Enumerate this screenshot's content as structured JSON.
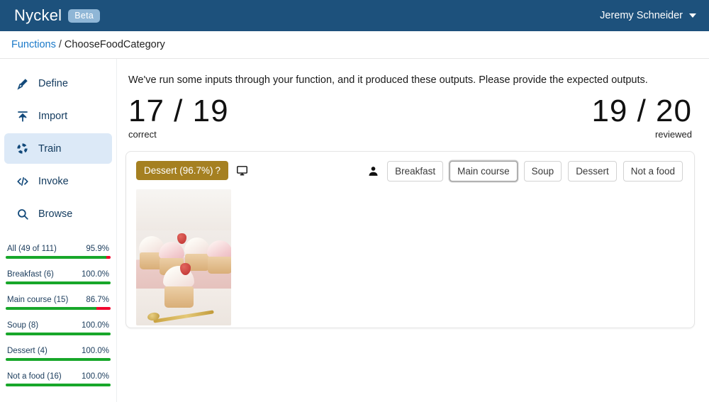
{
  "header": {
    "brand": "Nyckel",
    "beta_badge": "Beta",
    "user_name": "Jeremy Schneider",
    "bg_color": "#1d517c"
  },
  "breadcrumb": {
    "parent": "Functions",
    "separator": "/",
    "current": "ChooseFoodCategory"
  },
  "sidebar": {
    "items": [
      {
        "label": "Define",
        "icon": "brush-icon",
        "active": false
      },
      {
        "label": "Import",
        "icon": "upload-icon",
        "active": false
      },
      {
        "label": "Train",
        "icon": "train-icon",
        "active": true
      },
      {
        "label": "Invoke",
        "icon": "code-icon",
        "active": false
      },
      {
        "label": "Browse",
        "icon": "search-icon",
        "active": false
      }
    ],
    "stats": [
      {
        "label": "All (49 of 111)",
        "percent": "95.9%",
        "green": 95.9,
        "red": 4.1
      },
      {
        "label": "Breakfast (6)",
        "percent": "100.0%",
        "green": 100,
        "red": 0
      },
      {
        "label": "Main course (15)",
        "percent": "86.7%",
        "green": 86.7,
        "red": 13.3
      },
      {
        "label": "Soup (8)",
        "percent": "100.0%",
        "green": 100,
        "red": 0
      },
      {
        "label": "Dessert (4)",
        "percent": "100.0%",
        "green": 100,
        "red": 0
      },
      {
        "label": "Not a food (16)",
        "percent": "100.0%",
        "green": 100,
        "red": 0
      }
    ],
    "colors": {
      "bar_green": "#18a72a",
      "bar_red": "#f2072f",
      "active_bg": "#dce9f7"
    }
  },
  "main": {
    "intro": "We've run some inputs through your function, and it produced these outputs. Please provide the expected outputs.",
    "score_correct": {
      "value": "17 / 19",
      "label": "correct"
    },
    "score_reviewed": {
      "value": "19 / 20",
      "label": "reviewed"
    },
    "sample": {
      "prediction_label": "Dessert (96.7%)",
      "prediction_question_mark": "?",
      "prediction_color": "#a58021",
      "machine_icon": "monitor-icon",
      "person_icon": "person-icon",
      "choices": [
        {
          "label": "Breakfast",
          "selected": false
        },
        {
          "label": "Main course",
          "selected": true
        },
        {
          "label": "Soup",
          "selected": false
        },
        {
          "label": "Dessert",
          "selected": false
        },
        {
          "label": "Not a food",
          "selected": false
        }
      ]
    }
  }
}
